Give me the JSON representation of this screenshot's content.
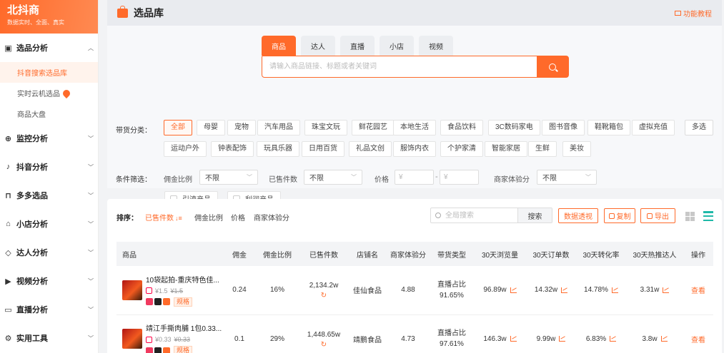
{
  "brand": {
    "name": "北抖商",
    "tagline": "数据实时、全面、真实"
  },
  "sidebar": {
    "groups": [
      {
        "label": "选品分析",
        "icon": "list-box-icon",
        "expanded": true,
        "items": [
          {
            "label": "抖音搜索选品库",
            "active": true
          },
          {
            "label": "实时云机选品",
            "hot": true
          },
          {
            "label": "商品大盘"
          }
        ]
      },
      {
        "label": "监控分析",
        "icon": "crosshair-icon"
      },
      {
        "label": "抖音分析",
        "icon": "tiktok-icon"
      },
      {
        "label": "多多选品",
        "icon": "shopping-bag-icon"
      },
      {
        "label": "小店分析",
        "icon": "store-icon"
      },
      {
        "label": "达人分析",
        "icon": "diamond-icon"
      },
      {
        "label": "视频分析",
        "icon": "video-icon"
      },
      {
        "label": "直播分析",
        "icon": "live-icon"
      },
      {
        "label": "实用工具",
        "icon": "tools-icon"
      }
    ]
  },
  "header": {
    "title": "选品库",
    "tutorial": "功能教程"
  },
  "search": {
    "tabs": [
      "商品",
      "达人",
      "直播",
      "小店",
      "视频"
    ],
    "active_tab": "商品",
    "placeholder": "请输入商品链接、标题或者关键词"
  },
  "category": {
    "label": "带货分类：",
    "multi": "多选",
    "chips": [
      "全部",
      "母婴",
      "宠物",
      "汽车用品",
      "珠宝文玩",
      "鲜花园艺",
      "本地生活",
      "食品饮料",
      "3C数码家电",
      "图书音像",
      "鞋靴箱包",
      "虚拟充值",
      "运动户外",
      "钟表配饰",
      "玩具乐器",
      "日用百货",
      "礼品文创",
      "服饰内衣",
      "个护家清",
      "智能家居",
      "生鲜",
      "美妆"
    ],
    "active": "全部"
  },
  "conditions": {
    "label": "条件筛选：",
    "commission_label": "佣金比例",
    "commission_value": "不限",
    "sold_label": "已售件数",
    "sold_value": "不限",
    "price_label": "价格",
    "price_min_placeholder": "¥",
    "price_max_placeholder": "¥",
    "merchant_label": "商家体验分",
    "merchant_value": "不限",
    "check_traffic": "引流产品",
    "check_profit": "利润产品"
  },
  "toolbar": {
    "sort_label": "排序：",
    "sort_options": [
      "已售件数",
      "佣金比例",
      "价格",
      "商家体验分"
    ],
    "active_sort": "已售件数",
    "search_placeholder": "全局搜索",
    "search_button": "搜索",
    "data_view": "数据透视",
    "copy": "复制",
    "export": "导出"
  },
  "table": {
    "headers": [
      "商品",
      "佣金",
      "佣金比例",
      "已售件数",
      "店铺名",
      "商家体验分",
      "带货类型",
      "30天浏览量",
      "30天订单数",
      "30天转化率",
      "30天热推达人",
      "操作"
    ],
    "rows": [
      {
        "name": "10袋起拍-重庆特色佳...",
        "price": "¥1.5",
        "orig_price": "¥1.5",
        "spec": "规格",
        "commission": "0.24",
        "ratio": "16%",
        "sold": "2,134.2w",
        "shop": "佳仙食品",
        "score": "4.88",
        "type_line1": "直播占比",
        "type_line2": "91.65%",
        "views": "96.89w",
        "orders": "14.32w",
        "conversion": "14.78%",
        "influencers": "3.31w",
        "action": "查看"
      },
      {
        "name": "靖江手撕肉脯 1包0.33...",
        "price": "¥0.33",
        "orig_price": "¥0.33",
        "spec": "规格",
        "commission": "0.1",
        "ratio": "29%",
        "sold": "1,448.65w",
        "shop": "靖鹏食品",
        "score": "4.73",
        "type_line1": "直播占比",
        "type_line2": "97.61%",
        "views": "146.3w",
        "orders": "9.99w",
        "conversion": "6.83%",
        "influencers": "3.8w",
        "action": "查看"
      }
    ]
  },
  "colors": {
    "accent": "#ff6a2a",
    "teal": "#1fb9a8"
  }
}
